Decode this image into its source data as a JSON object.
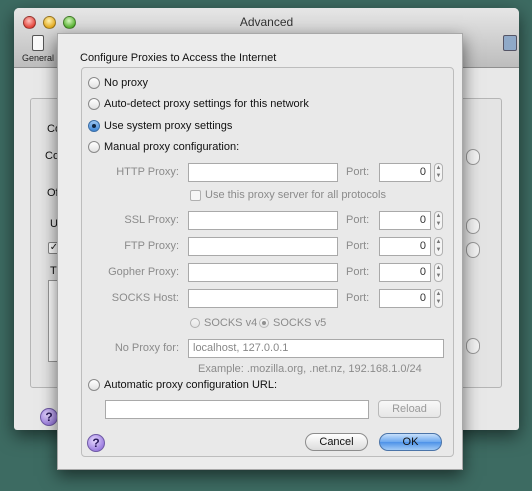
{
  "background_window": {
    "title": "Advanced",
    "toolbar_general_label": "General",
    "fragments": {
      "section1": "Co",
      "label1": "Co",
      "section2": "Of",
      "label2": "U",
      "checkbox_mark": "✓",
      "label3": "T"
    },
    "help_label": "?"
  },
  "sheet": {
    "title": "Configure Proxies to Access the Internet",
    "options": {
      "no_proxy": "No proxy",
      "auto_detect": "Auto-detect proxy settings for this network",
      "use_system": "Use system proxy settings",
      "manual": "Manual proxy configuration:",
      "auto_config_url": "Automatic proxy configuration URL:"
    },
    "selected_option": "use_system",
    "manual": {
      "port_label": "Port:",
      "http": {
        "label": "HTTP Proxy:",
        "value": "",
        "port": "0"
      },
      "same_proxy_checkbox": "Use this proxy server for all protocols",
      "ssl": {
        "label": "SSL Proxy:",
        "value": "",
        "port": "0"
      },
      "ftp": {
        "label": "FTP Proxy:",
        "value": "",
        "port": "0"
      },
      "gopher": {
        "label": "Gopher Proxy:",
        "value": "",
        "port": "0"
      },
      "socks": {
        "label": "SOCKS Host:",
        "value": "",
        "port": "0"
      },
      "socks_v4": "SOCKS v4",
      "socks_v5": "SOCKS v5",
      "socks_selected": "v5",
      "no_proxy_label": "No Proxy for:",
      "no_proxy_value": "localhost, 127.0.0.1",
      "example": "Example: .mozilla.org, .net.nz, 192.168.1.0/24"
    },
    "auto_config": {
      "url_value": "",
      "reload_label": "Reload"
    },
    "help_label": "?",
    "cancel_label": "Cancel",
    "ok_label": "OK",
    "stepper_up": "▲",
    "stepper_down": "▼"
  }
}
